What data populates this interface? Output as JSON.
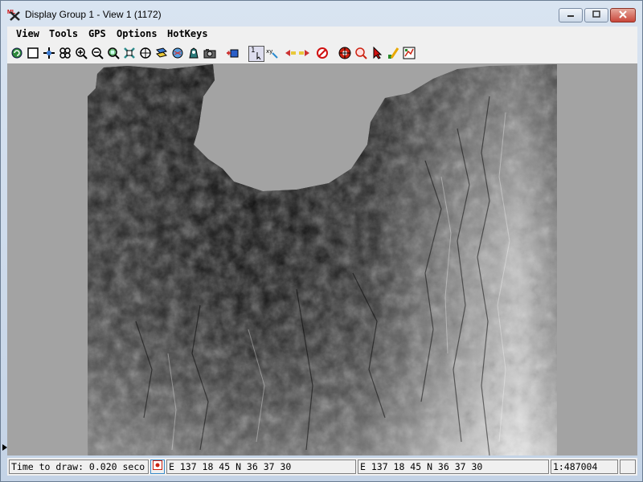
{
  "window": {
    "title": "Display Group 1 - View 1 (1172)",
    "icons": {
      "app": "tntmips-app-icon",
      "minimize": "minimize-icon",
      "maximize": "maximize-icon",
      "close": "close-icon"
    },
    "colors": {
      "close": "#c9463a",
      "frame": "#c4d3e6"
    }
  },
  "menu": {
    "items": [
      {
        "label": "View"
      },
      {
        "label": "Tools"
      },
      {
        "label": "GPS"
      },
      {
        "label": "Options"
      },
      {
        "label": "HotKeys"
      }
    ]
  },
  "toolbar": {
    "icons": [
      "redraw-icon",
      "full-view-icon",
      "pan-icon",
      "multi-pan-icon",
      "zoom-in-icon",
      "zoom-out-icon",
      "zoom-box-icon",
      "zoom-full-icon",
      "zoom-1x-icon",
      "layer-icon",
      "group-icon",
      "locate-icon",
      "snapshot-icon",
      "add-layer-icon",
      "select-1-icon",
      "select-xy-icon",
      "prev-next-icon",
      "goto-icon",
      "cancel-icon",
      "gps-icon",
      "zoom-magnify-icon",
      "select-arrow-icon",
      "edit-icon",
      "legend-icon"
    ],
    "select_badge": "1"
  },
  "canvas": {
    "image": "shaded-elevation-raster",
    "colors": {
      "background": "#a3a3a3",
      "dark": "#0a0a0a",
      "light": "#f2f2f2"
    }
  },
  "status": {
    "time_to_draw": "Time to draw: 0.020 seco",
    "position_icon": "gps-position-icon",
    "coords_1": "E 137 18 45   N 36 37 30",
    "coords_2": "E 137 18 45   N 36 37 30",
    "scale": "1:487004"
  }
}
